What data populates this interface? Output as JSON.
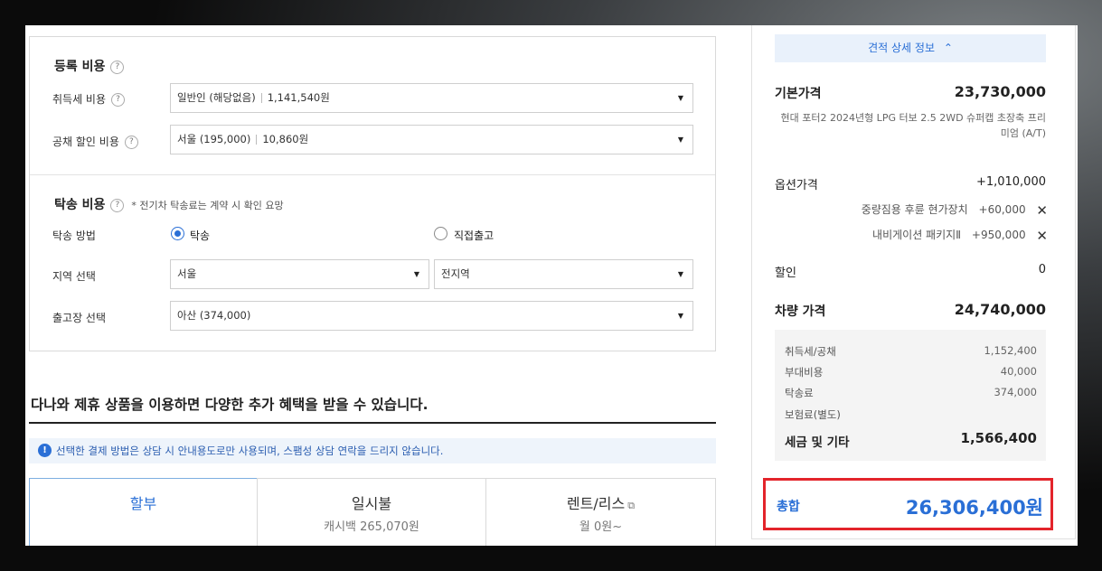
{
  "registration": {
    "title": "등록 비용",
    "acq_tax_label": "취득세 비용",
    "acq_tax_value": "일반인 (해당없음)",
    "acq_tax_amount": "1,141,540원",
    "bond_label": "공채 할인 비용",
    "bond_value": "서울 (195,000)",
    "bond_amount": "10,860원"
  },
  "delivery": {
    "title": "탁송 비용",
    "note": "* 전기차 탁송료는 계약 시 확인 요망",
    "method_label": "탁송 방법",
    "option_delivery": "탁송",
    "option_pickup": "직접출고",
    "region_label": "지역 선택",
    "region_value": "서울",
    "district_value": "전지역",
    "depot_label": "출고장 선택",
    "depot_value": "아산 (374,000)"
  },
  "promo": {
    "title": "다나와 제휴 상품을 이용하면 다양한 추가 혜택을 받을 수 있습니다.",
    "info": "선택한 결제 방법은 상담 시 안내용도로만 사용되며, 스팸성 상담 연락을 드리지 않습니다.",
    "tabs": [
      {
        "label": "할부",
        "sub": ""
      },
      {
        "label": "일시불",
        "sub": "캐시백 265,070원"
      },
      {
        "label": "렌트/리스",
        "sub": "월 0원~"
      }
    ]
  },
  "summary": {
    "detail_button": "견적 상세 정보",
    "base_price_label": "기본가격",
    "base_price": "23,730,000",
    "model_desc": "현대 포터2 2024년형 LPG 터보 2.5 2WD 슈퍼캡 초장축 프리미엄 (A/T)",
    "option_price_label": "옵션가격",
    "option_price": "+1,010,000",
    "options": [
      {
        "name": "중량짐용 후륜 현가장치",
        "price": "+60,000"
      },
      {
        "name": "내비게이션 패키지Ⅱ",
        "price": "+950,000"
      }
    ],
    "discount_label": "할인",
    "discount": "0",
    "vehicle_price_label": "차량 가격",
    "vehicle_price": "24,740,000",
    "fees": [
      {
        "label": "취득세/공채",
        "value": "1,152,400"
      },
      {
        "label": "부대비용",
        "value": "40,000"
      },
      {
        "label": "탁송료",
        "value": "374,000"
      },
      {
        "label": "보험료(별도)",
        "value": ""
      }
    ],
    "tax_total_label": "세금 및 기타",
    "tax_total": "1,566,400",
    "total_label": "총합",
    "total": "26,306,400원"
  },
  "icons": {
    "caret": "caret-down-icon",
    "help": "question-icon",
    "info": "info-icon",
    "close": "close-icon",
    "copy": "copy-icon",
    "chevron_up": "chevron-up-icon"
  },
  "colors": {
    "accent": "#2a6fd6",
    "highlight": "#e3242b"
  }
}
